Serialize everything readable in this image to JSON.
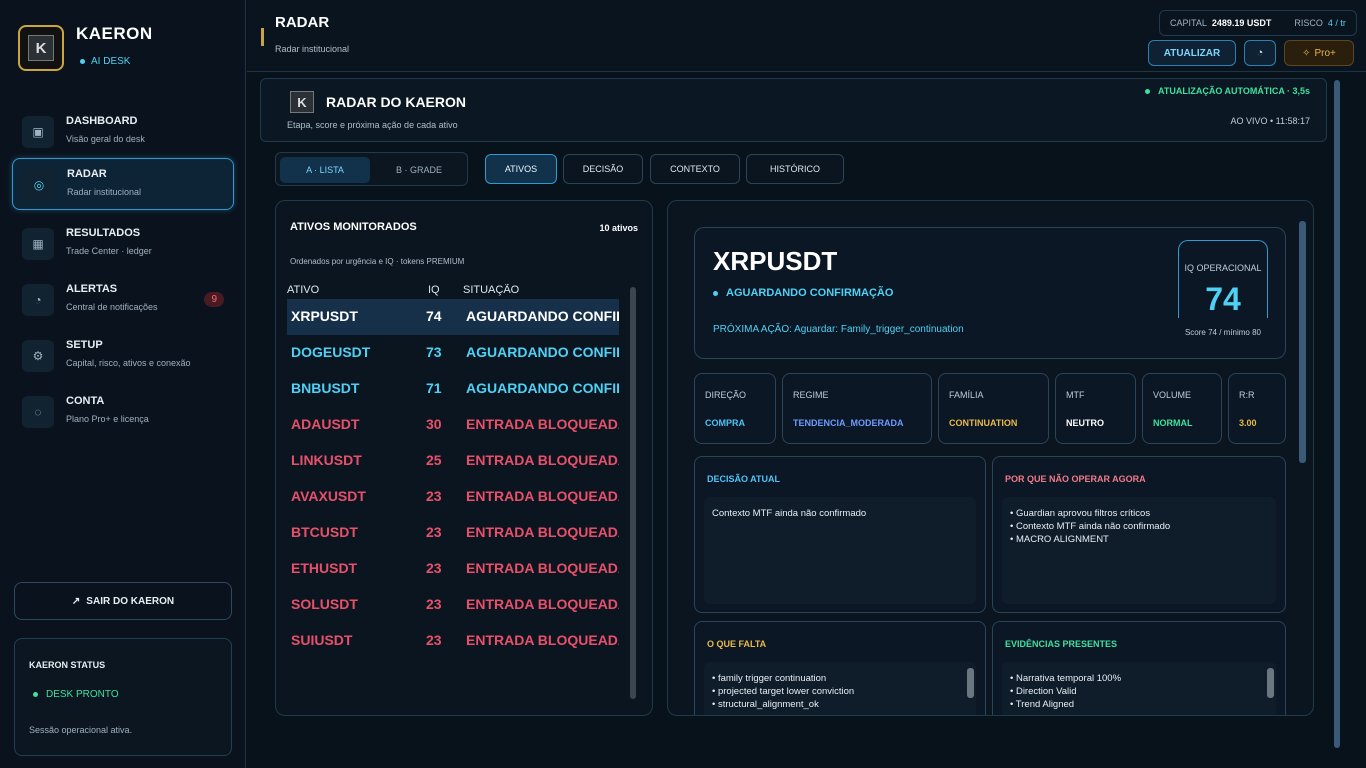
{
  "sidebar": {
    "brand": "KAERON",
    "badge": "AI DESK",
    "nav": [
      {
        "title": "DASHBOARD",
        "sub": "Visão geral do desk",
        "icon": "▣"
      },
      {
        "title": "RADAR",
        "sub": "Radar institucional",
        "icon": "◎"
      },
      {
        "title": "RESULTADOS",
        "sub": "Trade Center · ledger",
        "icon": "▦"
      },
      {
        "title": "ALERTAS",
        "sub": "Central de notificações",
        "icon": "◔",
        "count": "9"
      },
      {
        "title": "SETUP",
        "sub": "Capital, risco, ativos e conexão",
        "icon": "⚙"
      },
      {
        "title": "CONTA",
        "sub": "Plano Pro+ e licença",
        "icon": "◌"
      }
    ],
    "logout": "SAIR DO KAERON",
    "status_title": "KAERON STATUS",
    "status_state": "DESK PRONTO",
    "status_note": "Sessão operacional ativa."
  },
  "header": {
    "title": "RADAR",
    "subtitle": "Radar institucional",
    "capital_label": "CAPITAL",
    "capital_value": "2489.19 USDT",
    "risk_label": "RISCO",
    "risk_value": "4 / tr",
    "update_btn": "ATUALIZAR",
    "pro_btn": "Pro+"
  },
  "radar": {
    "title": "RADAR DO KAERON",
    "subtitle": "Etapa, score e próxima ação de cada ativo",
    "auto_update": "ATUALIZAÇÃO AUTOMÁTICA · 3,5s",
    "live": "AO VIVO  •  11:58:17",
    "views": [
      "A · LISTA",
      "B · GRADE"
    ],
    "tabs": [
      "ATIVOS",
      "DECISÃO",
      "CONTEXTO",
      "HISTÓRICO"
    ]
  },
  "assets": {
    "title": "ATIVOS MONITORADOS",
    "count": "10 ativos",
    "subtitle": "Ordenados por urgência e IQ · tokens PREMIUM",
    "headers": [
      "ATIVO",
      "IQ",
      "SITUAÇÃO"
    ],
    "rows": [
      {
        "symbol": "XRPUSDT",
        "iq": "74",
        "status": "AGUARDANDO CONFIRMAÇÃO",
        "tone": "white"
      },
      {
        "symbol": "DOGEUSDT",
        "iq": "73",
        "status": "AGUARDANDO CONFIRMAÇÃO",
        "tone": "cyan"
      },
      {
        "symbol": "BNBUSDT",
        "iq": "71",
        "status": "AGUARDANDO CONFIRMAÇÃO",
        "tone": "cyan"
      },
      {
        "symbol": "ADAUSDT",
        "iq": "30",
        "status": "ENTRADA BLOQUEADA",
        "tone": "red"
      },
      {
        "symbol": "LINKUSDT",
        "iq": "25",
        "status": "ENTRADA BLOQUEADA",
        "tone": "red"
      },
      {
        "symbol": "AVAXUSDT",
        "iq": "23",
        "status": "ENTRADA BLOQUEADA",
        "tone": "red"
      },
      {
        "symbol": "BTCUSDT",
        "iq": "23",
        "status": "ENTRADA BLOQUEADA",
        "tone": "red"
      },
      {
        "symbol": "ETHUSDT",
        "iq": "23",
        "status": "ENTRADA BLOQUEADA",
        "tone": "red"
      },
      {
        "symbol": "SOLUSDT",
        "iq": "23",
        "status": "ENTRADA BLOQUEADA",
        "tone": "red"
      },
      {
        "symbol": "SUIUSDT",
        "iq": "23",
        "status": "ENTRADA BLOQUEADA",
        "tone": "red"
      }
    ]
  },
  "detail": {
    "symbol": "XRPUSDT",
    "state": "AGUARDANDO CONFIRMAÇÃO",
    "next_action": "PRÓXIMA AÇÃO: Aguardar: Family_trigger_continuation",
    "iq_label": "IQ OPERACIONAL",
    "iq_value": "74",
    "iq_score": "Score 74 / mínimo 80",
    "metrics": [
      {
        "label": "DIREÇÃO",
        "value": "COMPRA",
        "color": "#4fc3f7"
      },
      {
        "label": "REGIME",
        "value": "TENDENCIA_MODERADA",
        "color": "#6f9bff"
      },
      {
        "label": "FAMÍLIA",
        "value": "CONTINUATION",
        "color": "#e9b949"
      },
      {
        "label": "MTF",
        "value": "NEUTRO",
        "color": "#ffffff"
      },
      {
        "label": "VOLUME",
        "value": "NORMAL",
        "color": "#3fe0a0"
      },
      {
        "label": "R:R",
        "value": "3.00",
        "color": "#e9b949"
      }
    ],
    "decision_title": "DECISÃO ATUAL",
    "decision_text": "Contexto MTF ainda não confirmado",
    "why_title": "POR QUE NÃO OPERAR AGORA",
    "why_items": [
      "• Guardian aprovou filtros críticos",
      "• Contexto MTF ainda não confirmado",
      "• MACRO ALIGNMENT"
    ],
    "missing_title": "O QUE FALTA",
    "missing_items": [
      "• family trigger continuation",
      "• projected target lower conviction",
      "• structural_alignment_ok"
    ],
    "evidence_title": "EVIDÊNCIAS PRESENTES",
    "evidence_items": [
      "• Narrativa temporal 100%",
      "• Direction Valid",
      "• Trend Aligned"
    ]
  },
  "colors": {
    "accent": "#2f9bd0",
    "cyan": "#4fd1f5",
    "red": "#e8506a",
    "green": "#3fe0a0",
    "gold": "#c9a642"
  }
}
